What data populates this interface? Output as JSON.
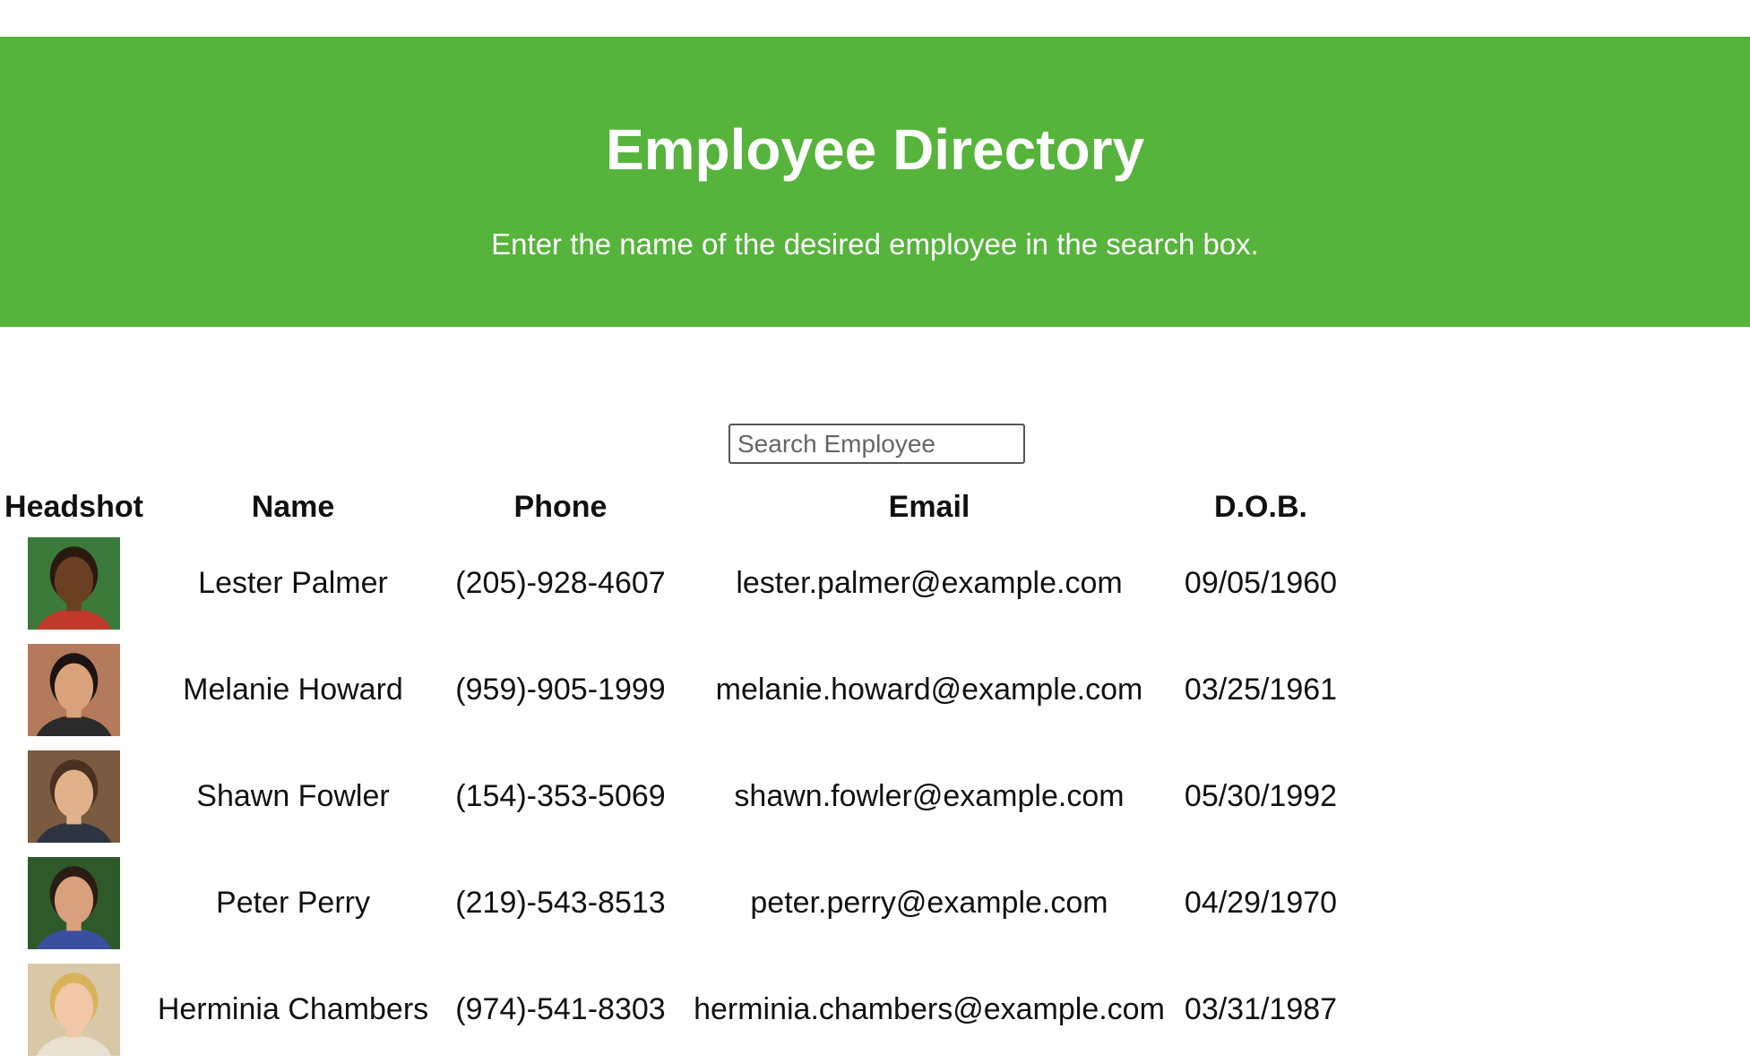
{
  "header": {
    "title": "Employee Directory",
    "subtitle": "Enter the name of the desired employee in the search box."
  },
  "search": {
    "placeholder": "Search Employee",
    "value": ""
  },
  "table": {
    "columns": [
      "Headshot",
      "Name",
      "Phone",
      "Email",
      "D.O.B."
    ],
    "rows": [
      {
        "name": "Lester Palmer",
        "phone": "(205)-928-4607",
        "email": "lester.palmer@example.com",
        "dob": "09/05/1960",
        "photo": {
          "bg": "#3b7a3a",
          "skin": "#6b3f24",
          "hair": "#2a1a10",
          "shirt": "#c0392b"
        }
      },
      {
        "name": "Melanie Howard",
        "phone": "(959)-905-1999",
        "email": "melanie.howard@example.com",
        "dob": "03/25/1961",
        "photo": {
          "bg": "#b47a5c",
          "skin": "#d9a27a",
          "hair": "#1b1410",
          "shirt": "#2b2b2b"
        }
      },
      {
        "name": "Shawn Fowler",
        "phone": "(154)-353-5069",
        "email": "shawn.fowler@example.com",
        "dob": "05/30/1992",
        "photo": {
          "bg": "#7a5a40",
          "skin": "#e0b08a",
          "hair": "#4a3020",
          "shirt": "#2d3640"
        }
      },
      {
        "name": "Peter Perry",
        "phone": "(219)-543-8513",
        "email": "peter.perry@example.com",
        "dob": "04/29/1970",
        "photo": {
          "bg": "#2e5a2a",
          "skin": "#d8a07c",
          "hair": "#2a1d14",
          "shirt": "#3b4fa0"
        }
      },
      {
        "name": "Herminia Chambers",
        "phone": "(974)-541-8303",
        "email": "herminia.chambers@example.com",
        "dob": "03/31/1987",
        "photo": {
          "bg": "#d8c8a8",
          "skin": "#f0c8a8",
          "hair": "#d9b25a",
          "shirt": "#e8e0d0"
        }
      }
    ]
  }
}
